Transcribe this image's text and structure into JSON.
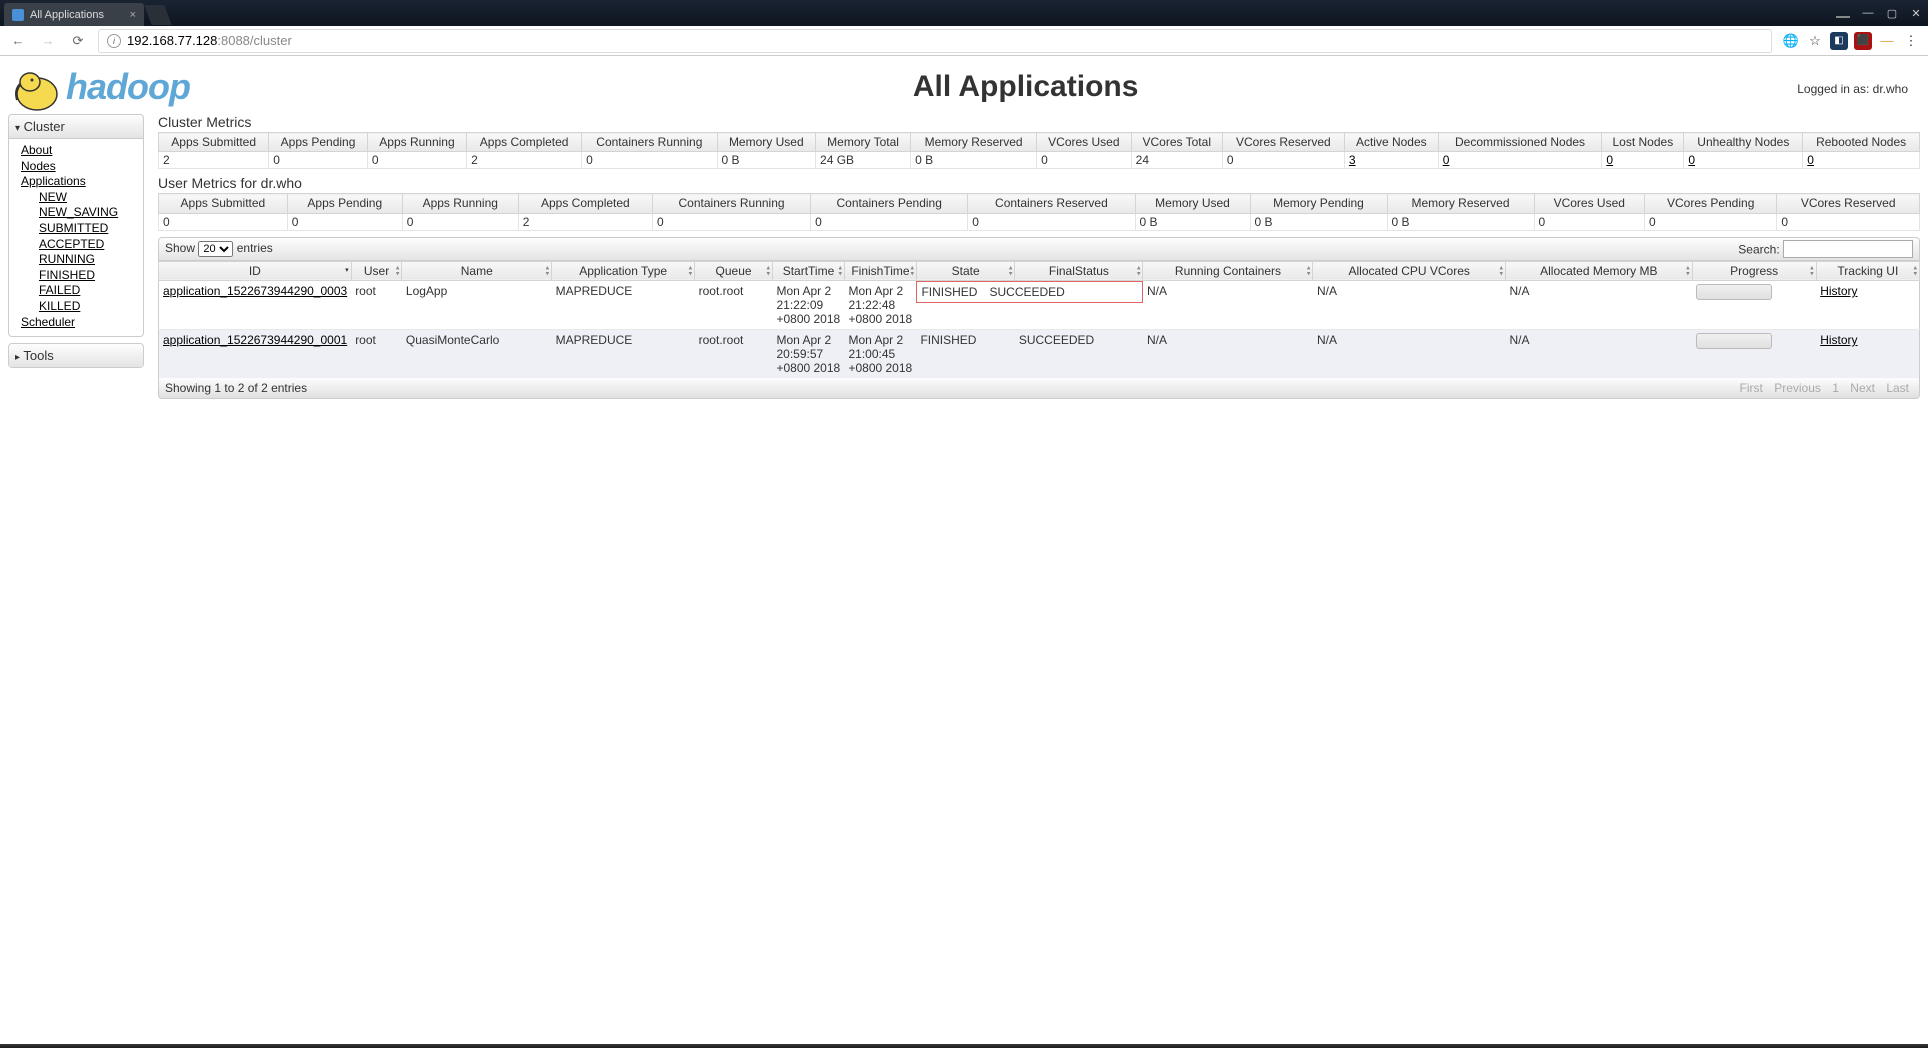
{
  "browser": {
    "tab_title": "All Applications",
    "url_host": "192.168.77.128",
    "url_port_path": ":8088/cluster"
  },
  "header": {
    "logo_text": "hadoop",
    "page_title": "All Applications",
    "logged_in": "Logged in as: dr.who"
  },
  "sidebar": {
    "cluster": {
      "label": "Cluster"
    },
    "links": {
      "about": "About",
      "nodes": "Nodes",
      "applications": "Applications",
      "scheduler": "Scheduler"
    },
    "app_states": {
      "new": "NEW",
      "new_saving": "NEW_SAVING",
      "submitted": "SUBMITTED",
      "accepted": "ACCEPTED",
      "running": "RUNNING",
      "finished": "FINISHED",
      "failed": "FAILED",
      "killed": "KILLED"
    },
    "tools": {
      "label": "Tools"
    }
  },
  "cluster_metrics": {
    "title": "Cluster Metrics",
    "headers": {
      "apps_submitted": "Apps Submitted",
      "apps_pending": "Apps Pending",
      "apps_running": "Apps Running",
      "apps_completed": "Apps Completed",
      "containers_running": "Containers Running",
      "memory_used": "Memory Used",
      "memory_total": "Memory Total",
      "memory_reserved": "Memory Reserved",
      "vcores_used": "VCores Used",
      "vcores_total": "VCores Total",
      "vcores_reserved": "VCores Reserved",
      "active_nodes": "Active Nodes",
      "decommissioned": "Decommissioned Nodes",
      "lost_nodes": "Lost Nodes",
      "unhealthy": "Unhealthy Nodes",
      "rebooted": "Rebooted Nodes"
    },
    "values": {
      "apps_submitted": "2",
      "apps_pending": "0",
      "apps_running": "0",
      "apps_completed": "2",
      "containers_running": "0",
      "memory_used": "0 B",
      "memory_total": "24 GB",
      "memory_reserved": "0 B",
      "vcores_used": "0",
      "vcores_total": "24",
      "vcores_reserved": "0",
      "active_nodes": "3",
      "decommissioned": "0",
      "lost_nodes": "0",
      "unhealthy": "0",
      "rebooted": "0"
    }
  },
  "user_metrics": {
    "title": "User Metrics for dr.who",
    "headers": {
      "apps_submitted": "Apps Submitted",
      "apps_pending": "Apps Pending",
      "apps_running": "Apps Running",
      "apps_completed": "Apps Completed",
      "containers_running": "Containers Running",
      "containers_pending": "Containers Pending",
      "containers_reserved": "Containers Reserved",
      "memory_used": "Memory Used",
      "memory_pending": "Memory Pending",
      "memory_reserved": "Memory Reserved",
      "vcores_used": "VCores Used",
      "vcores_pending": "VCores Pending",
      "vcores_reserved": "VCores Reserved"
    },
    "values": {
      "apps_submitted": "0",
      "apps_pending": "0",
      "apps_running": "0",
      "apps_completed": "2",
      "containers_running": "0",
      "containers_pending": "0",
      "containers_reserved": "0",
      "memory_used": "0 B",
      "memory_pending": "0 B",
      "memory_reserved": "0 B",
      "vcores_used": "0",
      "vcores_pending": "0",
      "vcores_reserved": "0"
    }
  },
  "datatable": {
    "show_label": "Show",
    "entries_label": "entries",
    "search_label": "Search:",
    "page_size": "20",
    "info": "Showing 1 to 2 of 2 entries",
    "paginate": {
      "first": "First",
      "previous": "Previous",
      "page": "1",
      "next": "Next",
      "last": "Last"
    }
  },
  "apps": {
    "headers": {
      "id": "ID",
      "user": "User",
      "name": "Name",
      "app_type": "Application Type",
      "queue": "Queue",
      "start": "StartTime",
      "finish": "FinishTime",
      "state": "State",
      "final_status": "FinalStatus",
      "running_containers": "Running Containers",
      "alloc_cpu": "Allocated CPU VCores",
      "alloc_mem": "Allocated Memory MB",
      "progress": "Progress",
      "tracking": "Tracking UI"
    },
    "rows": [
      {
        "id": "application_1522673944290_0003",
        "user": "root",
        "name": "LogApp",
        "app_type": "MAPREDUCE",
        "queue": "root.root",
        "start": "Mon Apr 2 21:22:09 +0800 2018",
        "finish": "Mon Apr 2 21:22:48 +0800 2018",
        "state": "FINISHED",
        "final_status": "SUCCEEDED",
        "running_containers": "N/A",
        "alloc_cpu": "N/A",
        "alloc_mem": "N/A",
        "tracking": "History"
      },
      {
        "id": "application_1522673944290_0001",
        "user": "root",
        "name": "QuasiMonteCarlo",
        "app_type": "MAPREDUCE",
        "queue": "root.root",
        "start": "Mon Apr 2 20:59:57 +0800 2018",
        "finish": "Mon Apr 2 21:00:45 +0800 2018",
        "state": "FINISHED",
        "final_status": "SUCCEEDED",
        "running_containers": "N/A",
        "alloc_cpu": "N/A",
        "alloc_mem": "N/A",
        "tracking": "History"
      }
    ]
  }
}
